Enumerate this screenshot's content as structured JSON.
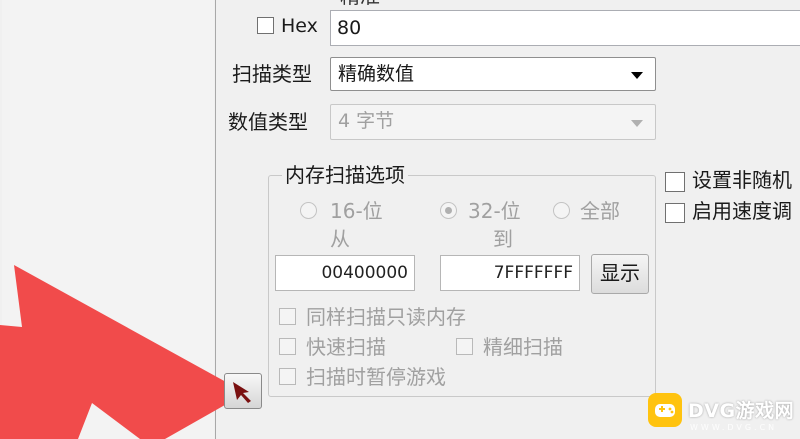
{
  "value": {
    "top_label_partial": "精准",
    "hex_label": "Hex",
    "hex_checked": false,
    "input_value": "80"
  },
  "scan_type": {
    "label": "扫描类型",
    "selected": "精确数值"
  },
  "value_type": {
    "label": "数值类型",
    "selected": "4 字节"
  },
  "memory_options": {
    "title": "内存扫描选项",
    "radios": [
      {
        "label_line1": "16-位",
        "label_line2": "从",
        "selected": false
      },
      {
        "label_line1": "32-位",
        "label_line2": "到",
        "selected": true
      },
      {
        "label_line1": "全部",
        "label_line2": "",
        "selected": false
      }
    ],
    "from_address": "00400000",
    "to_address": "7FFFFFFF",
    "show_button": "显示",
    "checkboxes": {
      "same_scan_readonly": "同样扫描只读内存",
      "fast_scan": "快速扫描",
      "fine_scan": "精细扫描",
      "pause_game": "扫描时暂停游戏"
    }
  },
  "right_options": {
    "non_random": "设置非随机",
    "speed_hack": "启用速度调"
  },
  "watermark": {
    "brand": "DVG游戏网",
    "sub": "WWW.DVG.CN"
  },
  "colors": {
    "arrow": "#f14b4b",
    "badge": "#ffc30f"
  }
}
